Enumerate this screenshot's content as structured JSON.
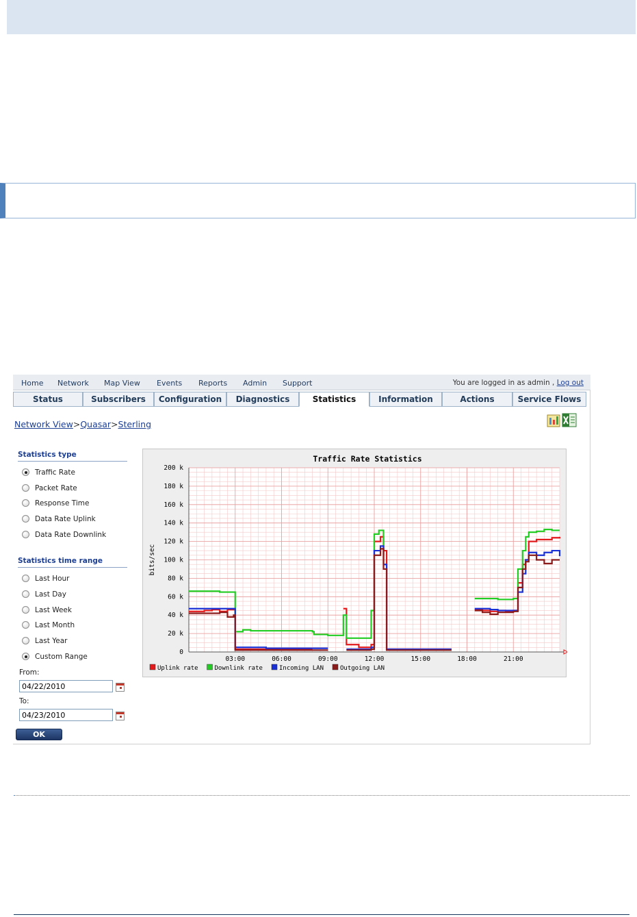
{
  "topnav": {
    "items": [
      "Home",
      "Network",
      "Map View",
      "Events",
      "Reports",
      "Admin",
      "Support"
    ],
    "login_text": "You are logged in as admin ,",
    "logout_label": "Log out"
  },
  "tabs": [
    {
      "label": "Status",
      "active": false
    },
    {
      "label": "Subscribers",
      "active": false
    },
    {
      "label": "Configuration",
      "active": false
    },
    {
      "label": "Diagnostics",
      "active": false
    },
    {
      "label": "Statistics",
      "active": true
    },
    {
      "label": "Information",
      "active": false
    },
    {
      "label": "Actions",
      "active": false
    },
    {
      "label": "Service Flows",
      "active": false
    }
  ],
  "breadcrumb": {
    "items": [
      "Network View",
      "Quasar",
      "Sterling"
    ],
    "separator": ">"
  },
  "export_icons": [
    "report-icon",
    "excel-icon"
  ],
  "stats_type": {
    "title": "Statistics type",
    "options": [
      {
        "label": "Traffic Rate",
        "selected": true
      },
      {
        "label": "Packet Rate",
        "selected": false
      },
      {
        "label": "Response Time",
        "selected": false
      },
      {
        "label": "Data Rate Uplink",
        "selected": false
      },
      {
        "label": "Data Rate Downlink",
        "selected": false
      }
    ]
  },
  "time_range": {
    "title": "Statistics time range",
    "options": [
      {
        "label": "Last Hour",
        "selected": false
      },
      {
        "label": "Last Day",
        "selected": false
      },
      {
        "label": "Last Week",
        "selected": false
      },
      {
        "label": "Last Month",
        "selected": false
      },
      {
        "label": "Last Year",
        "selected": false
      },
      {
        "label": "Custom Range",
        "selected": true
      }
    ],
    "from_label": "From:",
    "from_value": "04/22/2010",
    "to_label": "To:",
    "to_value": "04/23/2010",
    "ok_label": "OK"
  },
  "chart_data": {
    "type": "line",
    "title": "Traffic Rate Statistics",
    "ylabel": "bits/sec",
    "xlabel": "",
    "x_range": [
      0,
      24
    ],
    "x_ticks": [
      "03:00",
      "06:00",
      "09:00",
      "12:00",
      "15:00",
      "18:00",
      "21:00"
    ],
    "x_tick_values": [
      3,
      6,
      9,
      12,
      15,
      18,
      21
    ],
    "ylim": [
      0,
      200000
    ],
    "y_ticks": [
      "0",
      "20 k",
      "40 k",
      "60 k",
      "80 k",
      "100 k",
      "120 k",
      "140 k",
      "160 k",
      "180 k",
      "200 k"
    ],
    "grid": true,
    "legend_position": "bottom",
    "series": [
      {
        "name": "Uplink rate",
        "color": "#e31a1c",
        "points": [
          [
            0,
            44
          ],
          [
            1,
            45
          ],
          [
            1.5,
            46
          ],
          [
            2,
            44
          ],
          [
            2.5,
            46
          ],
          [
            3,
            3
          ],
          [
            4,
            3
          ],
          [
            5,
            3
          ],
          [
            6,
            3
          ],
          [
            7,
            3
          ],
          [
            8,
            3
          ],
          [
            9,
            null
          ],
          [
            9.8,
            null
          ],
          [
            10,
            47
          ],
          [
            10.2,
            8
          ],
          [
            11,
            5
          ],
          [
            11.8,
            8
          ],
          [
            12,
            120
          ],
          [
            12.4,
            125
          ],
          [
            12.6,
            110
          ],
          [
            12.8,
            3
          ],
          [
            14,
            3
          ],
          [
            15,
            3
          ],
          [
            16,
            3
          ],
          [
            17,
            3
          ],
          [
            17.5,
            null
          ],
          [
            18,
            null
          ],
          [
            18.5,
            46
          ],
          [
            19,
            45
          ],
          [
            19.5,
            44
          ],
          [
            20,
            45
          ],
          [
            20.5,
            44
          ],
          [
            21,
            45
          ],
          [
            21.3,
            75
          ],
          [
            21.6,
            95
          ],
          [
            21.8,
            100
          ],
          [
            22,
            120
          ],
          [
            22.5,
            122
          ],
          [
            23,
            122
          ],
          [
            23.5,
            124
          ],
          [
            24,
            125
          ]
        ]
      },
      {
        "name": "Downlink rate",
        "color": "#22cc22",
        "points": [
          [
            0,
            66
          ],
          [
            1,
            66
          ],
          [
            2,
            65
          ],
          [
            2.9,
            65
          ],
          [
            3,
            22
          ],
          [
            3.5,
            24
          ],
          [
            4,
            23
          ],
          [
            5,
            23
          ],
          [
            6,
            23
          ],
          [
            7,
            23
          ],
          [
            8,
            22
          ],
          [
            8.1,
            19
          ],
          [
            9,
            18
          ],
          [
            9.8,
            18
          ],
          [
            10,
            40
          ],
          [
            10.2,
            15
          ],
          [
            11,
            15
          ],
          [
            11.5,
            15
          ],
          [
            11.8,
            45
          ],
          [
            12,
            128
          ],
          [
            12.3,
            132
          ],
          [
            12.6,
            105
          ],
          [
            12.8,
            null
          ],
          [
            17.5,
            null
          ],
          [
            18,
            null
          ],
          [
            18.5,
            58
          ],
          [
            19,
            58
          ],
          [
            20,
            57
          ],
          [
            21,
            58
          ],
          [
            21.3,
            90
          ],
          [
            21.6,
            110
          ],
          [
            21.8,
            125
          ],
          [
            22,
            130
          ],
          [
            22.5,
            131
          ],
          [
            23,
            133
          ],
          [
            23.5,
            132
          ],
          [
            24,
            132
          ]
        ]
      },
      {
        "name": "Incoming LAN",
        "color": "#1a2fd4",
        "points": [
          [
            0,
            47
          ],
          [
            1,
            47
          ],
          [
            2,
            47
          ],
          [
            2.9,
            47
          ],
          [
            3,
            5
          ],
          [
            4,
            5
          ],
          [
            5,
            4
          ],
          [
            6,
            4
          ],
          [
            7,
            4
          ],
          [
            8,
            4
          ],
          [
            9,
            4
          ],
          [
            9.5,
            null
          ],
          [
            10,
            null
          ],
          [
            10.2,
            3
          ],
          [
            11,
            3
          ],
          [
            11.8,
            5
          ],
          [
            12,
            110
          ],
          [
            12.4,
            115
          ],
          [
            12.6,
            95
          ],
          [
            12.8,
            3
          ],
          [
            14,
            3
          ],
          [
            15,
            3
          ],
          [
            16,
            3
          ],
          [
            17,
            3
          ],
          [
            17.5,
            null
          ],
          [
            18,
            null
          ],
          [
            18.5,
            47
          ],
          [
            19,
            47
          ],
          [
            19.5,
            46
          ],
          [
            20,
            45
          ],
          [
            21,
            45
          ],
          [
            21.3,
            65
          ],
          [
            21.6,
            85
          ],
          [
            21.8,
            100
          ],
          [
            22,
            108
          ],
          [
            22.5,
            105
          ],
          [
            23,
            108
          ],
          [
            23.5,
            110
          ],
          [
            24,
            104
          ]
        ]
      },
      {
        "name": "Outgoing LAN",
        "color": "#8b1a1a",
        "points": [
          [
            0,
            42
          ],
          [
            1,
            42
          ],
          [
            2,
            43
          ],
          [
            2.5,
            38
          ],
          [
            2.9,
            40
          ],
          [
            3,
            2
          ],
          [
            4,
            2
          ],
          [
            5,
            2
          ],
          [
            6,
            2
          ],
          [
            7,
            2
          ],
          [
            8,
            2
          ],
          [
            9,
            2
          ],
          [
            9.5,
            null
          ],
          [
            10,
            null
          ],
          [
            10.2,
            2
          ],
          [
            11,
            2
          ],
          [
            11.8,
            3
          ],
          [
            12,
            105
          ],
          [
            12.4,
            112
          ],
          [
            12.6,
            90
          ],
          [
            12.8,
            2
          ],
          [
            14,
            2
          ],
          [
            15,
            2
          ],
          [
            16,
            2
          ],
          [
            17,
            2
          ],
          [
            17.5,
            null
          ],
          [
            18,
            null
          ],
          [
            18.5,
            45
          ],
          [
            19,
            43
          ],
          [
            19.5,
            41
          ],
          [
            20,
            43
          ],
          [
            21,
            44
          ],
          [
            21.3,
            70
          ],
          [
            21.6,
            90
          ],
          [
            21.8,
            98
          ],
          [
            22,
            105
          ],
          [
            22.5,
            100
          ],
          [
            23,
            96
          ],
          [
            23.5,
            100
          ],
          [
            24,
            100
          ]
        ]
      }
    ]
  }
}
